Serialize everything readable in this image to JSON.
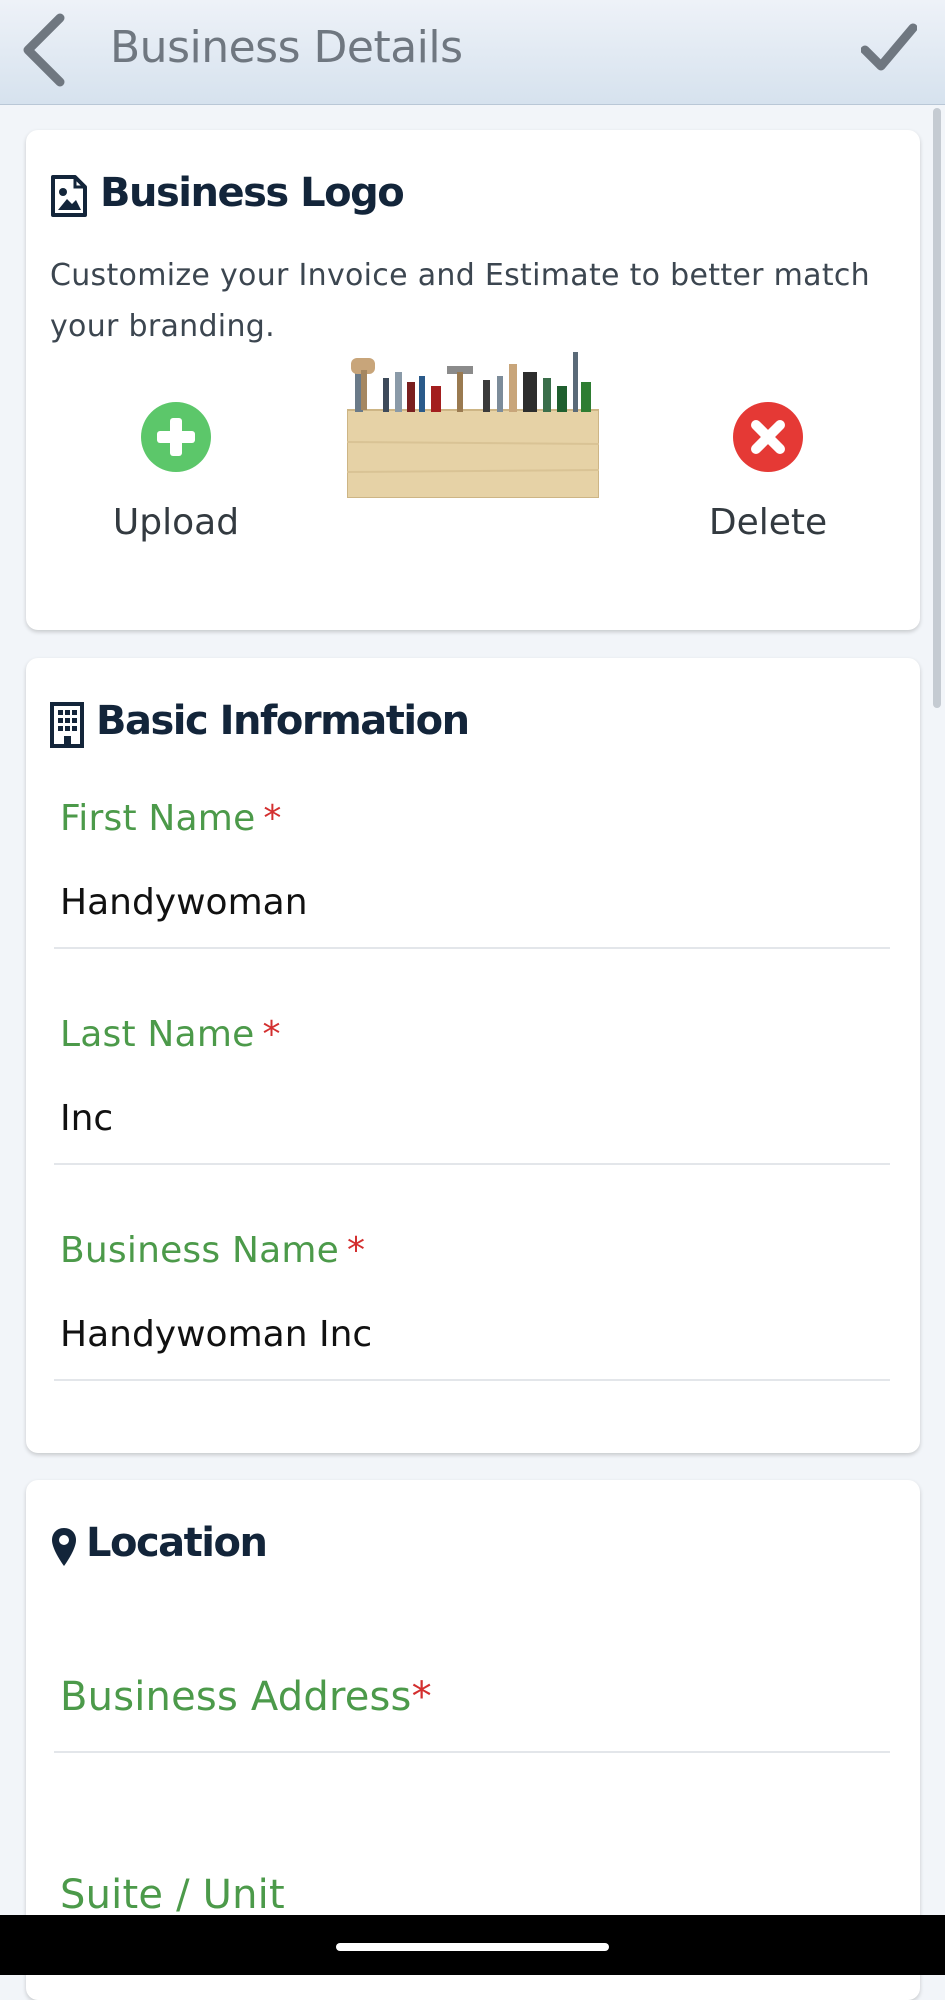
{
  "header": {
    "title": "Business Details",
    "back_icon": "chevron-left-icon",
    "confirm_icon": "checkmark-icon"
  },
  "logo_section": {
    "title": "Business Logo",
    "icon": "image-file-icon",
    "description": "Customize your Invoice and Estimate to better match your branding.",
    "upload_label": "Upload",
    "delete_label": "Delete",
    "upload_color": "#5cc76a",
    "delete_color": "#e53935"
  },
  "basic_info": {
    "title": "Basic Information",
    "icon": "building-icon",
    "fields": [
      {
        "label": "First Name",
        "required_mark": "*",
        "value": "Handywoman"
      },
      {
        "label": "Last Name",
        "required_mark": "*",
        "value": "Inc"
      },
      {
        "label": "Business Name",
        "required_mark": "*",
        "value": "Handywoman Inc"
      }
    ]
  },
  "location": {
    "title": "Location",
    "icon": "map-pin-icon",
    "address_label": "Business Address",
    "address_required_mark": "*",
    "suite_label": "Suite / Unit"
  },
  "colors": {
    "label_green": "#4c9a4a",
    "required_red": "#d32f2f",
    "title_navy": "#13253a"
  }
}
